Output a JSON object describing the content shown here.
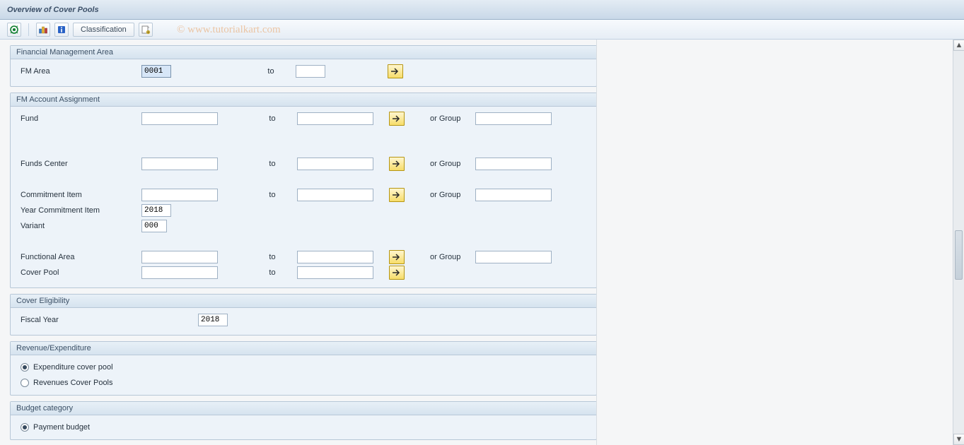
{
  "title": "Overview of Cover Pools",
  "watermark": "© www.tutorialkart.com",
  "toolbar": {
    "classification_label": "Classification"
  },
  "groups": {
    "fin_mgmt": {
      "title": "Financial Management Area",
      "fm_area_label": "FM Area",
      "fm_area_from": "0001",
      "to_label": "to",
      "fm_area_to": ""
    },
    "account_assign": {
      "title": "FM Account Assignment",
      "fund_label": "Fund",
      "to_label": "to",
      "or_group_label": "or Group",
      "fund_from": "",
      "fund_to": "",
      "fund_group": "",
      "funds_center_label": "Funds Center",
      "funds_center_from": "",
      "funds_center_to": "",
      "funds_center_group": "",
      "commitment_item_label": "Commitment Item",
      "commitment_item_from": "",
      "commitment_item_to": "",
      "commitment_item_group": "",
      "year_ci_label": "Year Commitment Item",
      "year_ci_value": "2018",
      "variant_label": "Variant",
      "variant_value": "000",
      "functional_area_label": "Functional Area",
      "functional_area_from": "",
      "functional_area_to": "",
      "functional_area_group": "",
      "cover_pool_label": "Cover Pool",
      "cover_pool_from": "",
      "cover_pool_to": ""
    },
    "cover_elig": {
      "title": "Cover Eligibility",
      "fiscal_year_label": "Fiscal Year",
      "fiscal_year_value": "2018"
    },
    "rev_exp": {
      "title": "Revenue/Expenditure",
      "opt_expenditure": "Expenditure cover pool",
      "opt_revenues": "Revenues Cover Pools",
      "selected": "expenditure"
    },
    "budget_cat": {
      "title": "Budget category",
      "opt_payment": "Payment budget",
      "selected": "payment"
    }
  }
}
